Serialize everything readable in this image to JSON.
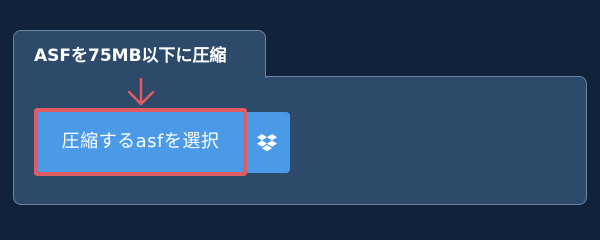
{
  "panel": {
    "tab_title": "ASFを75MB以下に圧縮"
  },
  "buttons": {
    "select_label": "圧縮するasfを選択",
    "dropbox_icon": "dropbox-icon"
  },
  "annotation": {
    "arrow_icon": "arrow-down-icon",
    "highlight_color": "#e05b62"
  },
  "colors": {
    "background": "#10233a",
    "panel": "#2d4a6b",
    "button": "#4a9ae8"
  }
}
